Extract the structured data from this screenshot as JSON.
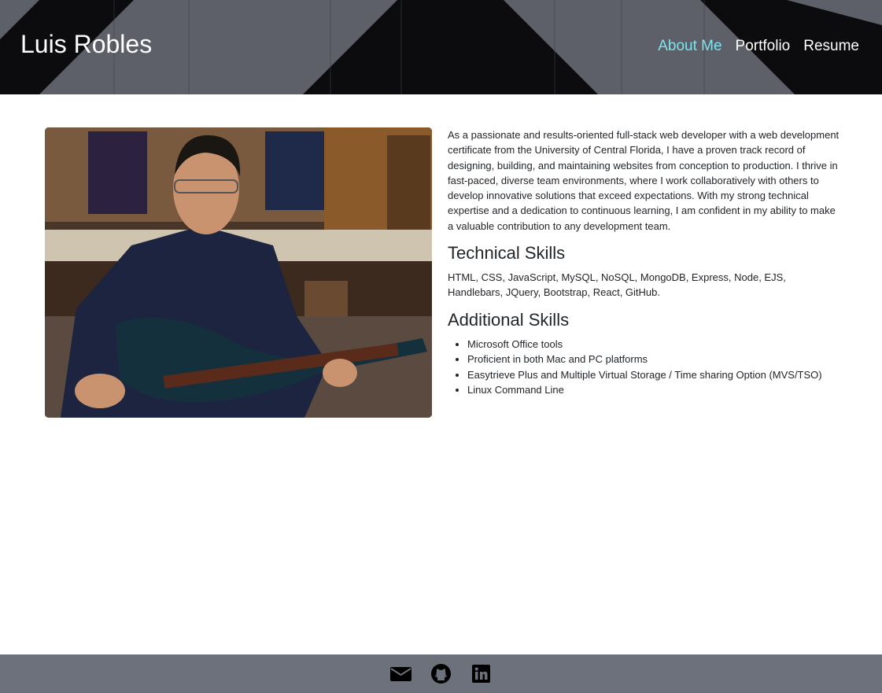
{
  "header": {
    "site_title": "Luis Robles",
    "nav": [
      {
        "label": "About Me",
        "active": true
      },
      {
        "label": "Portfolio",
        "active": false
      },
      {
        "label": "Resume",
        "active": false
      }
    ],
    "active_color": "#7fe3ec"
  },
  "about": {
    "bio": "As a passionate and results-oriented full-stack web developer with a web development certificate from the University of Central Florida, I have a proven track record of designing, building, and maintaining websites from conception to production. I thrive in fast-paced, diverse team environments, where I work collaboratively with others to develop innovative solutions that exceed expectations. With my strong technical expertise and a dedication to continuous learning, I am confident in my ability to make a valuable contribution to any development team.",
    "technical_heading": "Technical Skills",
    "technical_skills": "HTML, CSS, JavaScript, MySQL, NoSQL, MongoDB, Express, Node, EJS, Handlebars, JQuery, Bootstrap, React, GitHub.",
    "additional_heading": "Additional Skills",
    "additional_skills": [
      "Microsoft Office tools",
      "Proficient in both Mac and PC platforms",
      "Easytrieve Plus and Multiple Virtual Storage / Time sharing Option (MVS/TSO)",
      "Linux Command Line"
    ]
  },
  "footer": {
    "icons": [
      "envelope-icon",
      "github-icon",
      "linkedin-icon"
    ],
    "background": "#6c717b"
  }
}
